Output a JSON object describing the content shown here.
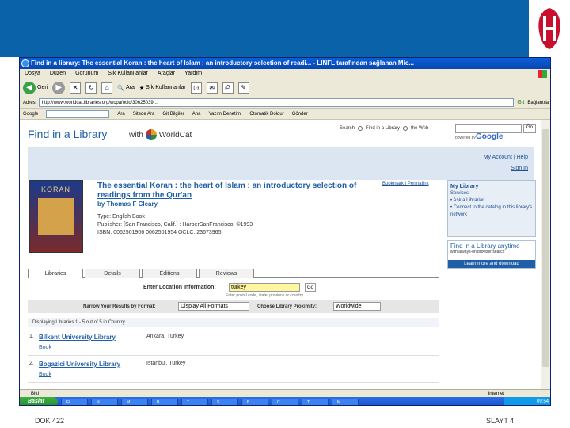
{
  "slide": {
    "footer_left": "DOK 422",
    "footer_right": "SLAYT 4",
    "banner_color": "#0a63a8"
  },
  "browser": {
    "title": "Find in a library: The essential Koran : the heart of Islam : an introductory selection of readi... - LINFL tarafından sağlanan Mic...",
    "menu": [
      "Dosya",
      "Düzen",
      "Görünüm",
      "Sık Kullanılanlar",
      "Araçlar",
      "Yardım"
    ],
    "toolbar": {
      "back": "Geri",
      "search": "Ara",
      "favorites": "Sık Kullanılanlar"
    },
    "address_label": "Adres",
    "address_url": "http://www.worldcat.libraries.org/wcpa/oclc/30625039...",
    "go_label": "Git",
    "links_label": "Bağlantılar",
    "links_items": [
      "Google",
      "Ara",
      "Sitede Ara",
      "Git Bilgiler",
      "Ana",
      "Yazım Denetimi",
      "Otomatik Doldur",
      "Gönder"
    ],
    "status_text": "Bitti",
    "status_zone": "Internet",
    "start_label": "Başlat",
    "task_items": [
      "Fi...",
      "N...",
      "M...",
      "B...",
      "T...",
      "S...",
      "B...",
      "C...",
      "T...",
      "M..."
    ],
    "clock": "09:54"
  },
  "page": {
    "header_title": "Find in a Library",
    "header_with": "with",
    "worldcat": "WorldCat",
    "search_label": "Search",
    "search_opt1": "Find in a Library",
    "search_opt2": "the Web",
    "go": "Go",
    "powered_by": "powered by",
    "google": "Google",
    "my_account": "My Account  |  Help",
    "sign_in": "Sign In",
    "cover_title": "KORAN",
    "book_title": "The essential Koran : the heart of Islam : an introductory selection of readings from the Qur'an",
    "book_author": "by Thomas F Cleary",
    "meta_type": "Type: English  Book",
    "meta_publisher": "Publisher: [San Francisco, Calif.] : HarperSanFrancisco, ©1993",
    "meta_isbn": "ISBN: 0062501906 0062501954   OCLC: 23673965",
    "bookmark": "Bookmark | Permalink",
    "mylib_title": "My Library",
    "mylib_line1": "Services",
    "mylib_line2": "• Ask a Librarian",
    "mylib_line3": "• Connect to the catalog in this library's network",
    "anytime_title": "Find in a Library anytime",
    "anytime_sub": "with always-on browser search",
    "anytime_btn": "Learn more and download",
    "tabs": [
      "Libraries",
      "Details",
      "Editions",
      "Reviews"
    ],
    "location_label": "Enter Location Information:",
    "location_value": "turkey",
    "ok_label": "Go",
    "location_hint": "Enter postal code, state, province or country",
    "narrow_label": "Narrow Your Results by Format:",
    "format_value": "Display All Formats",
    "proximity_label": "Choose Library Proximity:",
    "proximity_value": "Worldwide",
    "displaying": "Displaying Libraries 1 - 5 out of 5 in Country",
    "libraries": [
      {
        "num": "1.",
        "name": "Bilkent University Library",
        "city": "Ankara, Turkey",
        "type": "Book"
      },
      {
        "num": "2.",
        "name": "Bogazici University Library",
        "city": "Istanbul, Turkey",
        "type": "Book"
      }
    ]
  }
}
